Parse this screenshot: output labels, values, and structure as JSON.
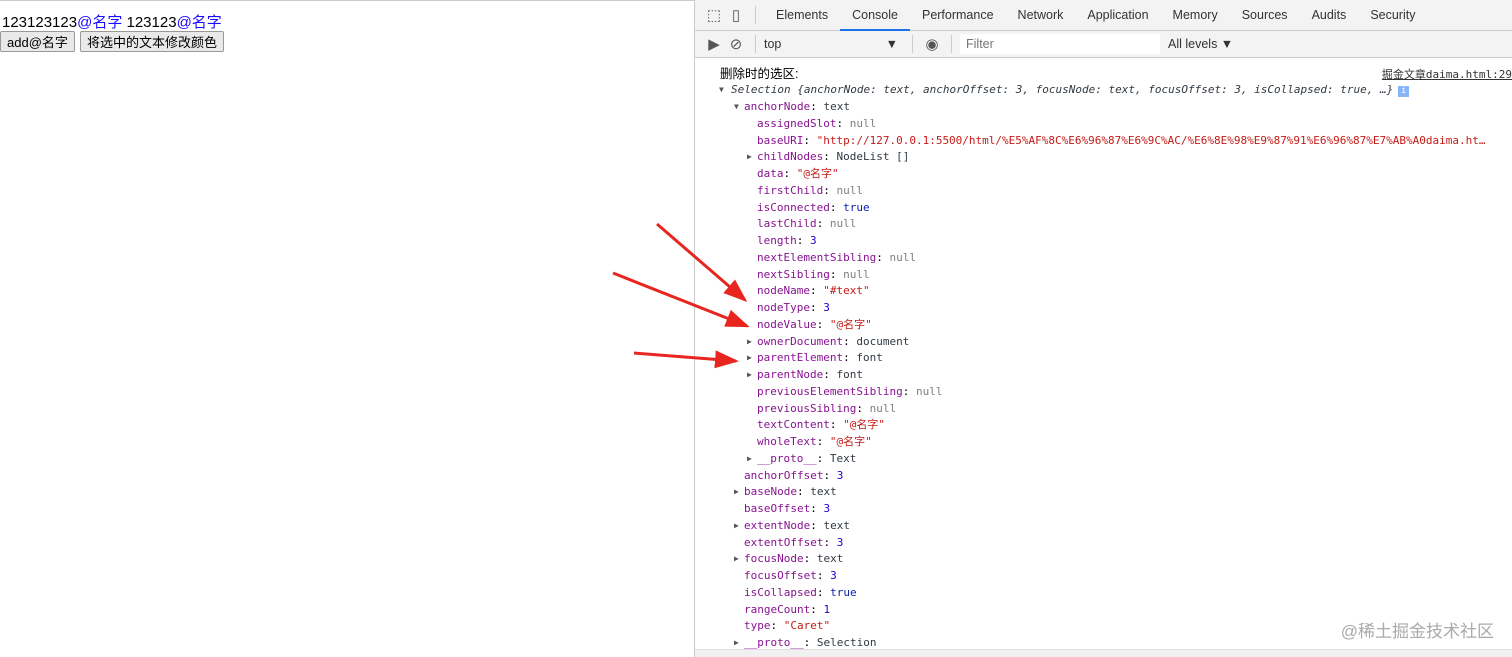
{
  "page": {
    "text_parts": [
      "123123123",
      "@名字",
      " 123123",
      "@名字"
    ],
    "buttons": [
      "add@名字",
      "将选中的文本修改颜色"
    ]
  },
  "devtools": {
    "tabs": [
      "Elements",
      "Console",
      "Performance",
      "Network",
      "Application",
      "Memory",
      "Sources",
      "Audits",
      "Security"
    ],
    "active_tab": "Console",
    "context": "top",
    "filter_placeholder": "Filter",
    "levels": "All levels ▼"
  },
  "console": {
    "label": "删除时的选区:",
    "source": "掘金文章daima.html:29",
    "summary": "Selection {anchorNode: text, anchorOffset: 3, focusNode: text, focusOffset: 3, isCollapsed: true, …}",
    "rows": [
      {
        "l": 1,
        "exp": "open",
        "k": "anchorNode",
        "v": "text",
        "t": "o"
      },
      {
        "l": 2,
        "k": "assignedSlot",
        "v": "null",
        "t": "nl"
      },
      {
        "l": 2,
        "k": "baseURI",
        "v": "\"http://127.0.0.1:5500/html/%E5%AF%8C%E6%96%87%E6%9C%AC/%E6%8E%98%E9%87%91%E6%96%87%E7%AB%A0daima.ht…",
        "t": "s"
      },
      {
        "l": 2,
        "exp": "closed",
        "k": "childNodes",
        "v": "NodeList []",
        "t": "o"
      },
      {
        "l": 2,
        "k": "data",
        "v": "\"@名字\"",
        "t": "s"
      },
      {
        "l": 2,
        "k": "firstChild",
        "v": "null",
        "t": "nl"
      },
      {
        "l": 2,
        "k": "isConnected",
        "v": "true",
        "t": "b"
      },
      {
        "l": 2,
        "k": "lastChild",
        "v": "null",
        "t": "nl"
      },
      {
        "l": 2,
        "k": "length",
        "v": "3",
        "t": "n"
      },
      {
        "l": 2,
        "k": "nextElementSibling",
        "v": "null",
        "t": "nl"
      },
      {
        "l": 2,
        "k": "nextSibling",
        "v": "null",
        "t": "nl"
      },
      {
        "l": 2,
        "k": "nodeName",
        "v": "\"#text\"",
        "t": "s"
      },
      {
        "l": 2,
        "k": "nodeType",
        "v": "3",
        "t": "n"
      },
      {
        "l": 2,
        "k": "nodeValue",
        "v": "\"@名字\"",
        "t": "s"
      },
      {
        "l": 2,
        "exp": "closed",
        "k": "ownerDocument",
        "v": "document",
        "t": "o"
      },
      {
        "l": 2,
        "exp": "closed",
        "k": "parentElement",
        "v": "font",
        "t": "o"
      },
      {
        "l": 2,
        "exp": "closed",
        "k": "parentNode",
        "v": "font",
        "t": "o"
      },
      {
        "l": 2,
        "k": "previousElementSibling",
        "v": "null",
        "t": "nl"
      },
      {
        "l": 2,
        "k": "previousSibling",
        "v": "null",
        "t": "nl"
      },
      {
        "l": 2,
        "k": "textContent",
        "v": "\"@名字\"",
        "t": "s"
      },
      {
        "l": 2,
        "k": "wholeText",
        "v": "\"@名字\"",
        "t": "s"
      },
      {
        "l": 2,
        "exp": "closed",
        "k": "__proto__",
        "v": "Text",
        "t": "o"
      },
      {
        "l": 1,
        "k": "anchorOffset",
        "v": "3",
        "t": "n"
      },
      {
        "l": 1,
        "exp": "closed",
        "k": "baseNode",
        "v": "text",
        "t": "o"
      },
      {
        "l": 1,
        "k": "baseOffset",
        "v": "3",
        "t": "n"
      },
      {
        "l": 1,
        "exp": "closed",
        "k": "extentNode",
        "v": "text",
        "t": "o"
      },
      {
        "l": 1,
        "k": "extentOffset",
        "v": "3",
        "t": "n"
      },
      {
        "l": 1,
        "exp": "closed",
        "k": "focusNode",
        "v": "text",
        "t": "o"
      },
      {
        "l": 1,
        "k": "focusOffset",
        "v": "3",
        "t": "n"
      },
      {
        "l": 1,
        "k": "isCollapsed",
        "v": "true",
        "t": "b"
      },
      {
        "l": 1,
        "k": "rangeCount",
        "v": "1",
        "t": "n"
      },
      {
        "l": 1,
        "k": "type",
        "v": "\"Caret\"",
        "t": "s"
      },
      {
        "l": 1,
        "exp": "closed",
        "k": "__proto__",
        "v": "Selection",
        "t": "o"
      }
    ]
  },
  "watermark": "@稀土掘金技术社区",
  "colors": {
    "arrow": "#e8261f",
    "link_blue": "#1a0dff",
    "tab_active": "#1a73e8"
  }
}
